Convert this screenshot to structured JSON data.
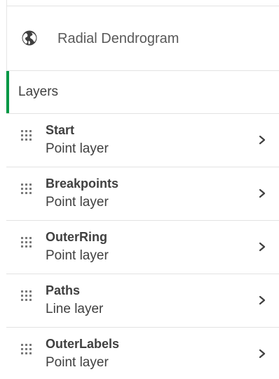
{
  "header": {
    "title": "Radial Dendrogram",
    "icon": "globe-icon"
  },
  "section": {
    "label": "Layers",
    "accent_color": "#009845"
  },
  "layers": [
    {
      "name": "Start",
      "type": "Point layer"
    },
    {
      "name": "Breakpoints",
      "type": "Point layer"
    },
    {
      "name": "OuterRing",
      "type": "Point layer"
    },
    {
      "name": "Paths",
      "type": "Line layer"
    },
    {
      "name": "OuterLabels",
      "type": "Point layer"
    }
  ],
  "icons": {
    "drag": "drag-handle-icon",
    "chevron": "chevron-right-icon"
  }
}
